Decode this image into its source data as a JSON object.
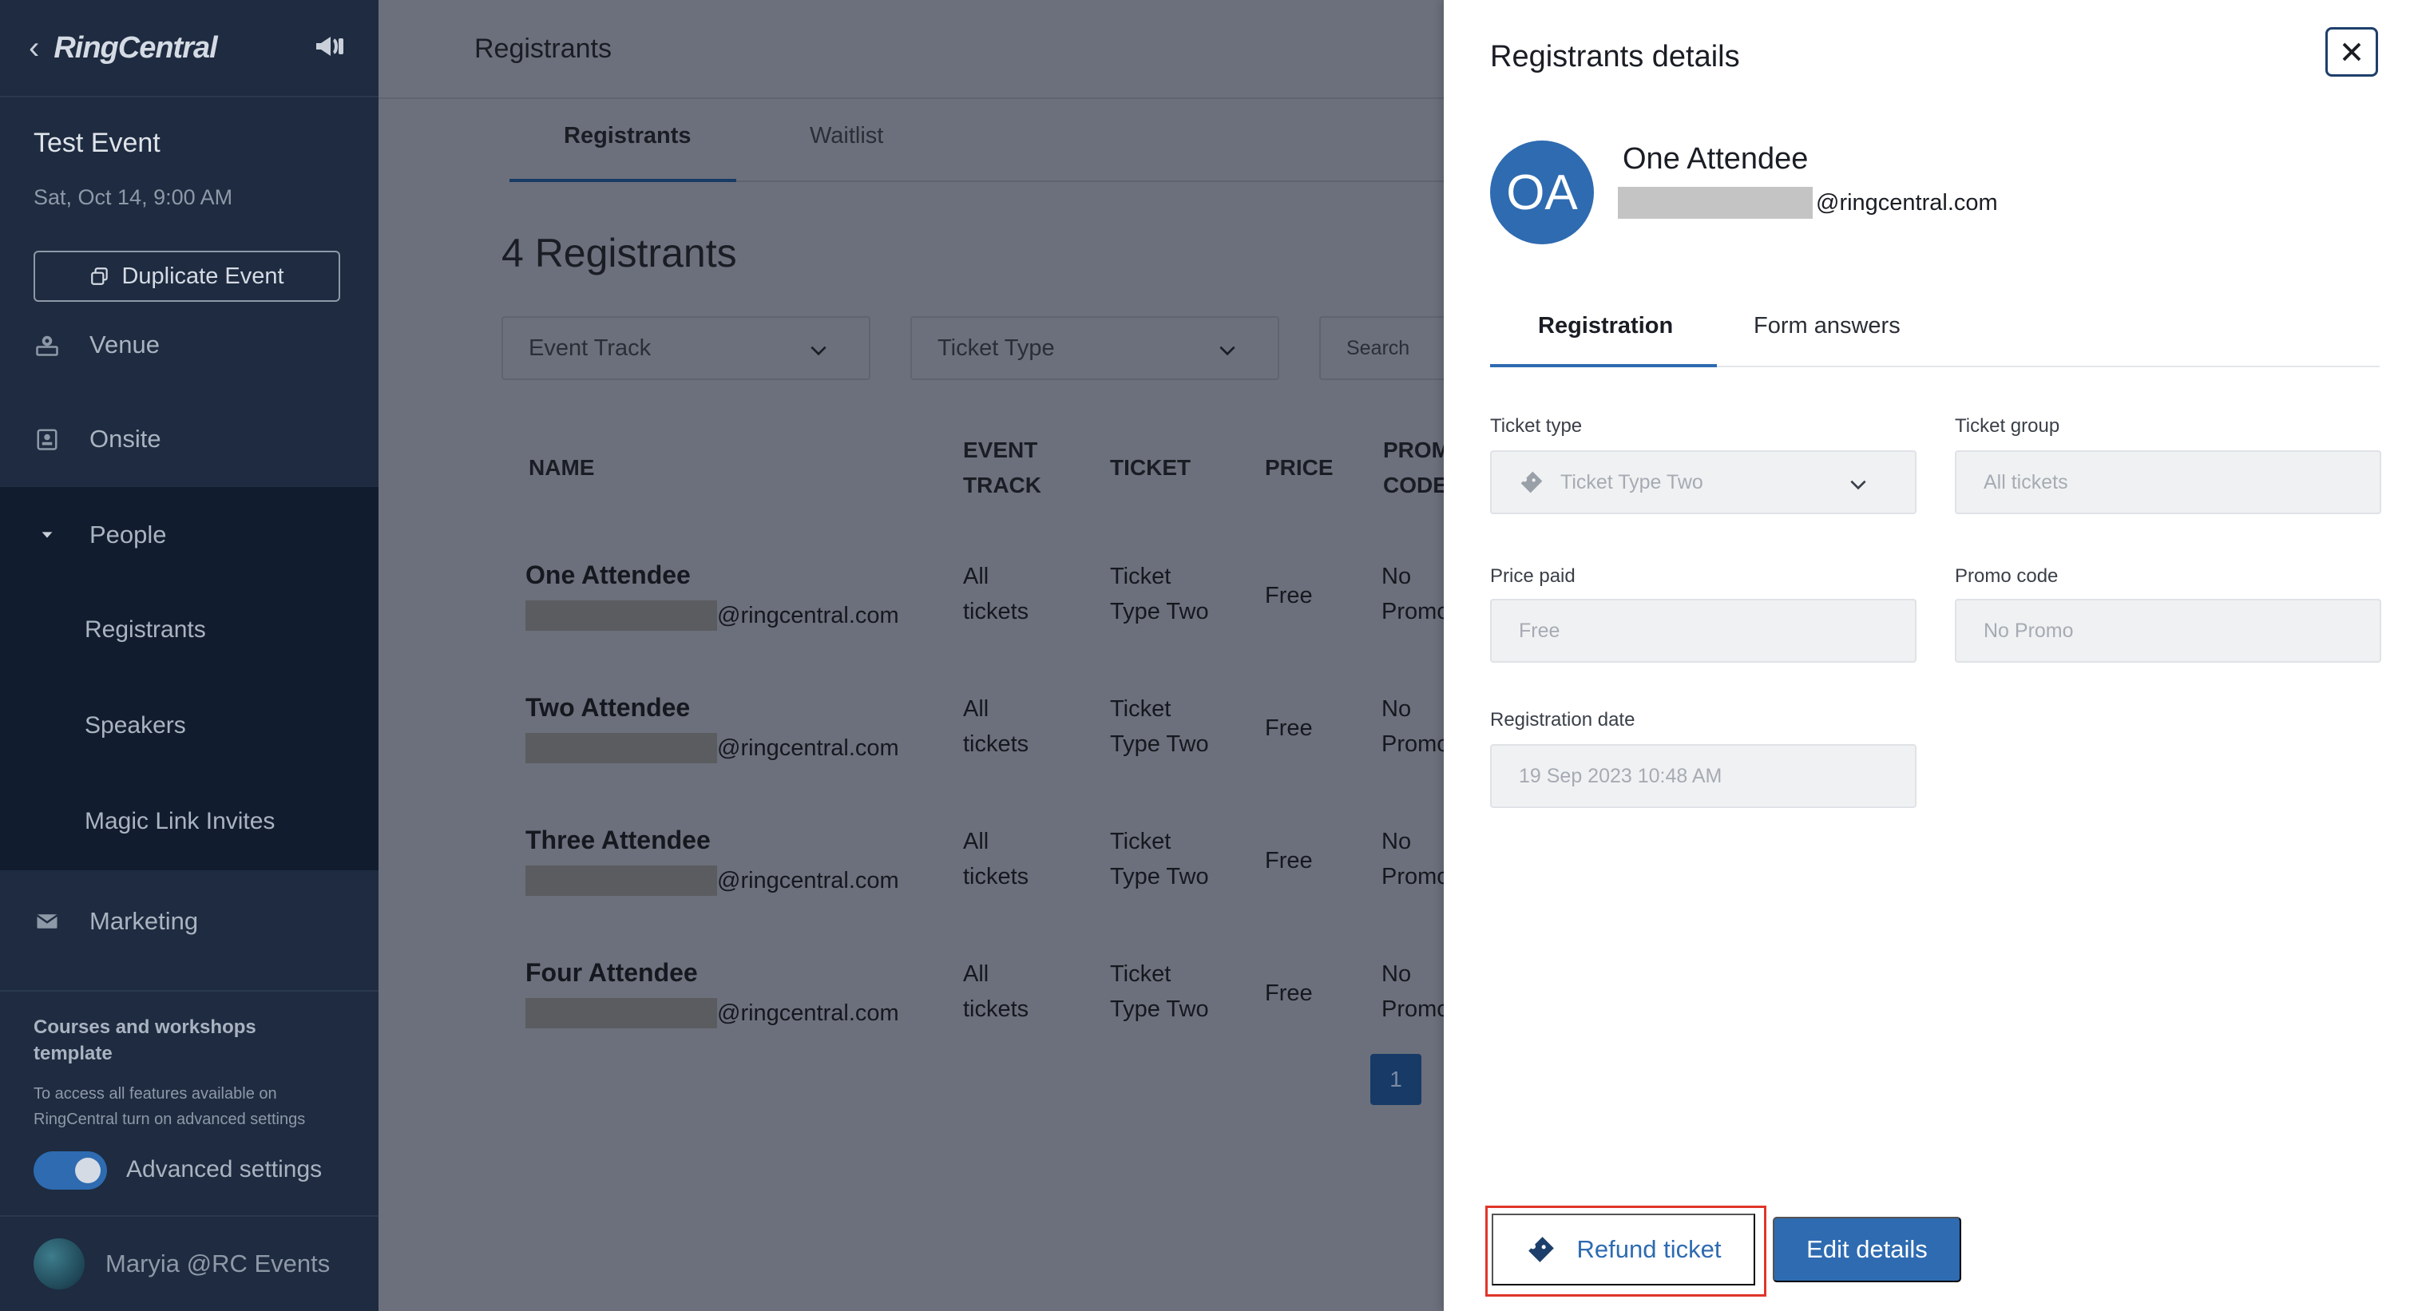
{
  "sidebar": {
    "brand": "RingCentral",
    "event_title": "Test Event",
    "event_date": "Sat, Oct 14, 9:00 AM",
    "duplicate_label": "Duplicate Event",
    "items": {
      "venue": "Venue",
      "onsite": "Onsite",
      "people": "People",
      "registrants": "Registrants",
      "speakers": "Speakers",
      "magic_link": "Magic Link Invites",
      "marketing": "Marketing"
    },
    "template_title": "Courses and workshops template",
    "template_desc": "To access all features available on RingCentral turn on advanced settings",
    "advanced_label": "Advanced settings",
    "advanced_on": true,
    "user_name": "Maryia @RC Events"
  },
  "main": {
    "header_title": "Registrants",
    "tabs": {
      "registrants": "Registrants",
      "waitlist": "Waitlist"
    },
    "count_label": "4 Registrants",
    "filters": {
      "event_track": "Event Track",
      "ticket_type": "Ticket Type",
      "search": "Search"
    },
    "columns": {
      "name": "NAME",
      "event_track_1": "EVENT",
      "event_track_2": "TRACK",
      "ticket": "TICKET",
      "price": "PRICE",
      "promo_1": "PROMO",
      "promo_2": "CODE"
    },
    "rows": [
      {
        "name": "One Attendee",
        "email_domain": "@ringcentral.com",
        "track_1": "All",
        "track_2": "tickets",
        "ticket_1": "Ticket",
        "ticket_2": "Type Two",
        "price": "Free",
        "promo_1": "No",
        "promo_2": "Promo"
      },
      {
        "name": "Two Attendee",
        "email_domain": "@ringcentral.com",
        "track_1": "All",
        "track_2": "tickets",
        "ticket_1": "Ticket",
        "ticket_2": "Type Two",
        "price": "Free",
        "promo_1": "No",
        "promo_2": "Promo"
      },
      {
        "name": "Three Attendee",
        "email_domain": "@ringcentral.com",
        "track_1": "All",
        "track_2": "tickets",
        "ticket_1": "Ticket",
        "ticket_2": "Type Two",
        "price": "Free",
        "promo_1": "No",
        "promo_2": "Promo"
      },
      {
        "name": "Four Attendee",
        "email_domain": "@ringcentral.com",
        "track_1": "All",
        "track_2": "tickets",
        "ticket_1": "Ticket",
        "ticket_2": "Type Two",
        "price": "Free",
        "promo_1": "No",
        "promo_2": "Promo"
      }
    ],
    "page_number": "1"
  },
  "panel": {
    "title": "Registrants details",
    "avatar_initials": "OA",
    "attendee_name": "One Attendee",
    "attendee_email_domain": "@ringcentral.com",
    "tabs": {
      "registration": "Registration",
      "form_answers": "Form answers"
    },
    "fields": {
      "ticket_type_label": "Ticket type",
      "ticket_type_value": "Ticket Type Two",
      "ticket_group_label": "Ticket group",
      "ticket_group_value": "All tickets",
      "price_paid_label": "Price paid",
      "price_paid_value": "Free",
      "promo_code_label": "Promo code",
      "promo_code_value": "No Promo",
      "reg_date_label": "Registration date",
      "reg_date_value": "19 Sep 2023 10:48 AM"
    },
    "refund_label": "Refund ticket",
    "edit_label": "Edit details"
  },
  "colors": {
    "sidebar_bg": "#1e2b40",
    "sidebar_active_bg": "#111c2e",
    "primary": "#2e6bb1",
    "highlight": "#e0352a",
    "overlay_main": "#6c707c"
  },
  "icons": [
    "back-chevron-icon",
    "megaphone-icon",
    "copy-icon",
    "venue-pin-icon",
    "onsite-badge-icon",
    "caret-down-icon",
    "mail-icon",
    "chevron-down-icon",
    "close-icon",
    "ticket-icon"
  ]
}
